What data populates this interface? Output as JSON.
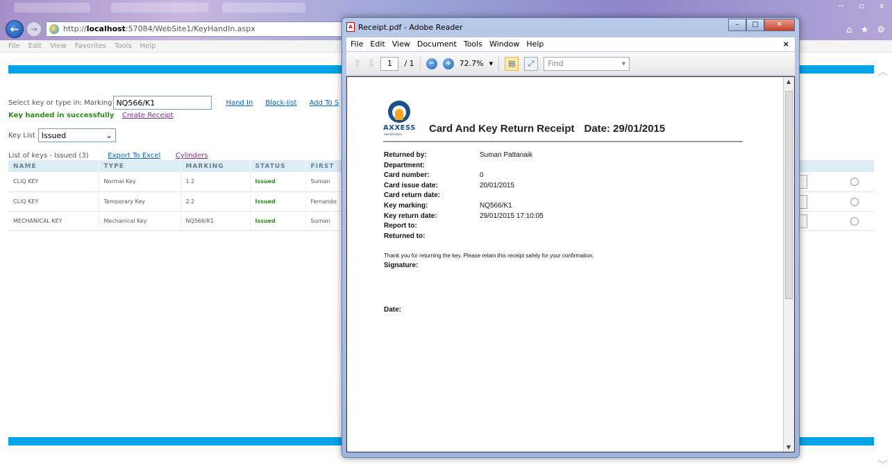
{
  "browser": {
    "url_prefix": "http://",
    "url_host": "localhost",
    "url_rest": ":57084/WebSite1/KeyHandIn.aspx",
    "menu": [
      "File",
      "Edit",
      "View",
      "Favorites",
      "Tools",
      "Help"
    ]
  },
  "page": {
    "select_label": "Select key or type in: Marking",
    "marking_value": "NQ566/K1",
    "links": {
      "hand_in": "Hand In",
      "black_list": "Black-list",
      "add_to": "Add To S",
      "create_receipt": "Create Receipt",
      "export_excel": "Export To Excel",
      "cylinders": "Cylinders"
    },
    "success_message": "Key handed in successfully",
    "key_list_label": "Key List",
    "key_list_value": "Issued",
    "list_info": "List of keys - Issued (3)",
    "table": {
      "headers": [
        "NAME",
        "TYPE",
        "MARKING",
        "STATUS",
        "FIRST"
      ],
      "rows": [
        [
          "CLIQ KEY",
          "Normal Key",
          "1.2",
          "Issued",
          "Suman"
        ],
        [
          "CLIQ KEY",
          "Temporary Key",
          "2.2",
          "Issued",
          "Fernando"
        ],
        [
          "MECHANICAL KEY",
          "Mechanical Key",
          "NQ566/K1",
          "Issued",
          "Suman"
        ]
      ]
    }
  },
  "reader": {
    "title": "Receipt.pdf - Adobe Reader",
    "menu": [
      "File",
      "Edit",
      "View",
      "Document",
      "Tools",
      "Window",
      "Help"
    ],
    "page_current": "1",
    "page_total": "/ 1",
    "zoom": "72.7%",
    "find_placeholder": "Find"
  },
  "receipt": {
    "logo_text": "AXXESS",
    "logo_sub": "identification",
    "title": "Card And Key Return Receipt",
    "date": "Date: 29/01/2015",
    "fields": [
      {
        "label": "Returned by:",
        "value": "Suman Pattanaik"
      },
      {
        "label": "Department:",
        "value": ""
      },
      {
        "label": "Card number:",
        "value": "0"
      },
      {
        "label": "Card issue date:",
        "value": "20/01/2015"
      },
      {
        "label": "Card return date:",
        "value": ""
      },
      {
        "label": "Key marking:",
        "value": "NQ566/K1"
      },
      {
        "label": "Key return date:",
        "value": "29/01/2015 17:10:05"
      },
      {
        "label": "Report to:",
        "value": ""
      },
      {
        "label": "Returned to:",
        "value": ""
      }
    ],
    "thanks": "Thank you for returning the key. Please retain this receipt safely for your confirmation.",
    "signature_label": "Signature:",
    "date_label": "Date:"
  },
  "colors": {
    "accent_bar": "#00a3e8",
    "success": "#2d8a20",
    "link": "#0066cc"
  }
}
